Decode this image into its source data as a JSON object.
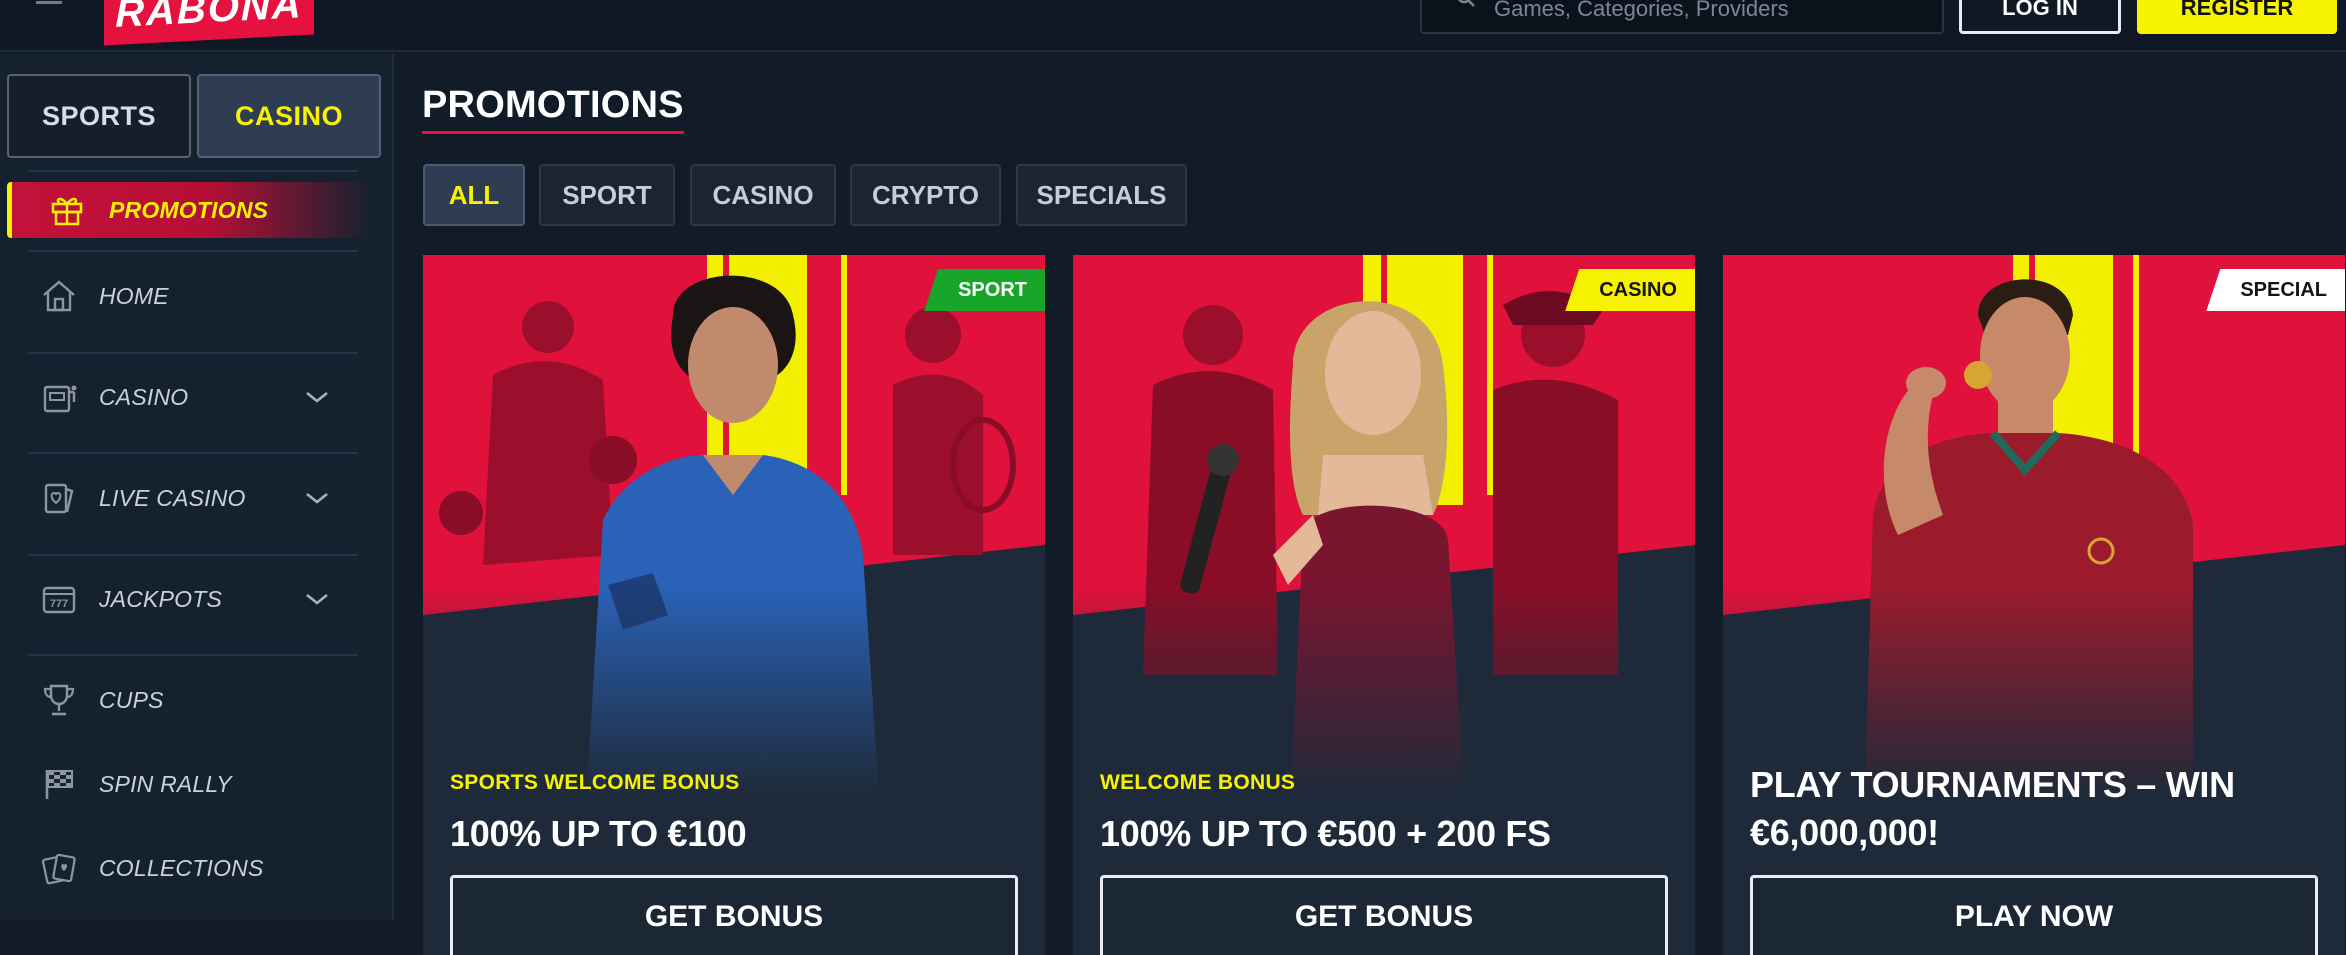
{
  "header": {
    "logo_text": "RABONA",
    "search_placeholder": "Games, Categories, Providers",
    "login_label": "LOG IN",
    "register_label": "REGISTER"
  },
  "sidebar": {
    "switch_sports": "SPORTS",
    "switch_casino": "CASINO",
    "items": [
      {
        "label": "PROMOTIONS",
        "icon": "gift-icon",
        "active": true
      },
      {
        "label": "HOME",
        "icon": "home-icon"
      },
      {
        "label": "CASINO",
        "icon": "slot-machine-icon",
        "expandable": true
      },
      {
        "label": "LIVE CASINO",
        "icon": "cards-icon",
        "expandable": true
      },
      {
        "label": "JACKPOTS",
        "icon": "jackpot-777-icon",
        "expandable": true
      },
      {
        "label": "CUPS",
        "icon": "trophy-icon"
      },
      {
        "label": "SPIN RALLY",
        "icon": "checkered-flag-icon"
      },
      {
        "label": "COLLECTIONS",
        "icon": "collections-icon"
      }
    ]
  },
  "main": {
    "title": "PROMOTIONS",
    "filters": [
      "ALL",
      "SPORT",
      "CASINO",
      "CRYPTO",
      "SPECIALS"
    ],
    "active_filter": "ALL",
    "cards": [
      {
        "tag": "SPORT",
        "subtitle": "SPORTS WELCOME BONUS",
        "headline": "100% UP TO €100",
        "cta": "GET BONUS"
      },
      {
        "tag": "CASINO",
        "subtitle": "WELCOME BONUS",
        "headline": "100% UP TO €500 + 200 FS",
        "cta": "GET BONUS"
      },
      {
        "tag": "SPECIAL",
        "subtitle": "",
        "headline": "PLAY TOURNAMENTS – WIN €6,000,000!",
        "cta": "PLAY NOW"
      }
    ]
  },
  "colors": {
    "accent_red": "#e5113f",
    "accent_yellow": "#f6f200",
    "tag_green": "#17a52a",
    "background": "#121b28"
  }
}
